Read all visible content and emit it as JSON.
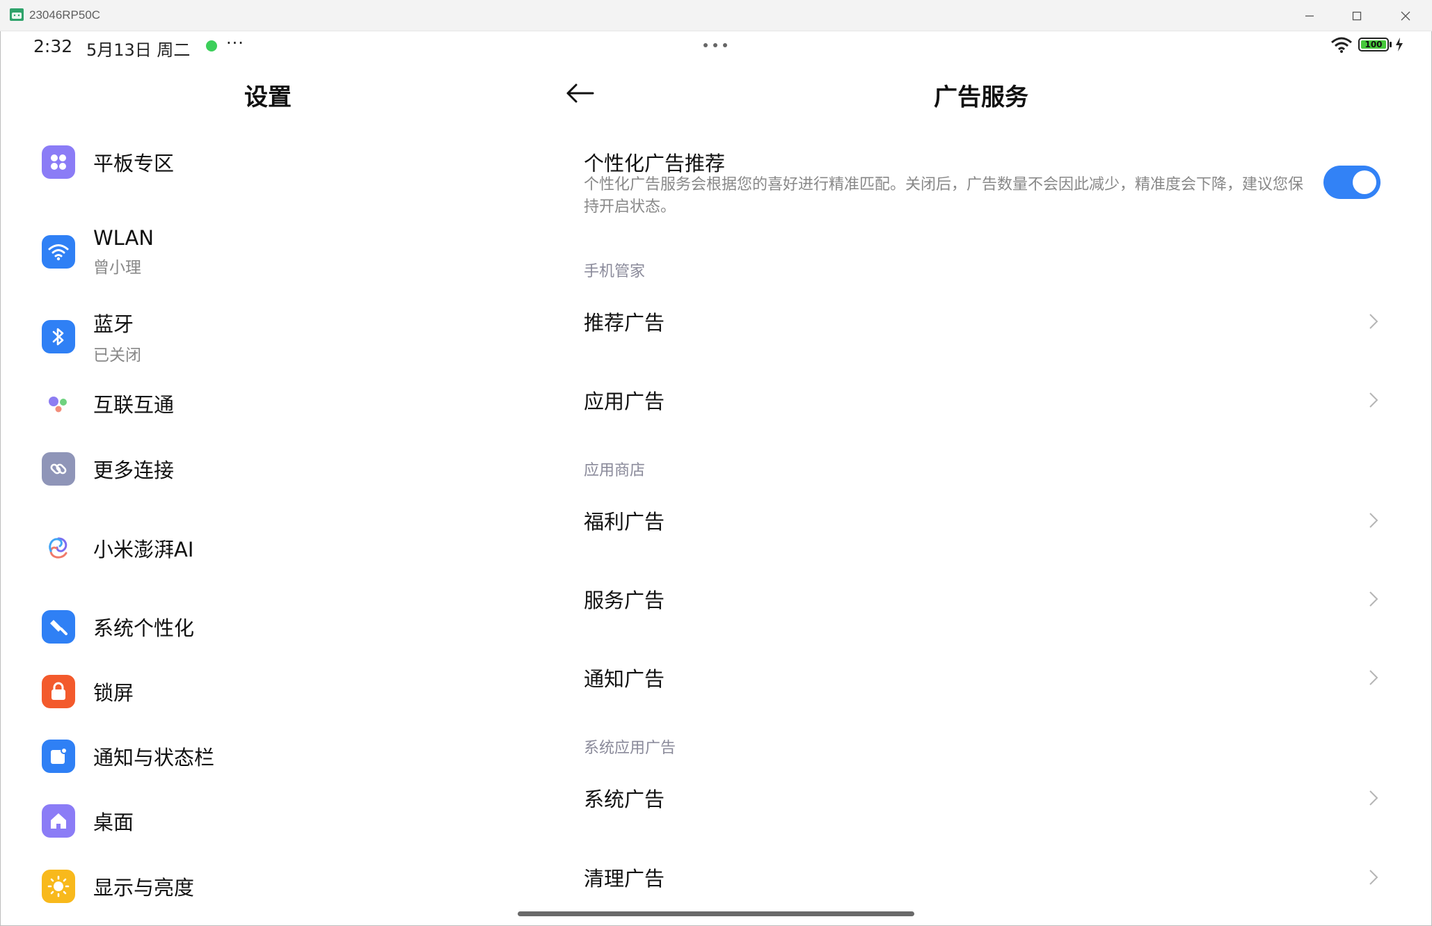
{
  "window": {
    "title": "23046RP50C"
  },
  "status_bar": {
    "time": "2:32",
    "date": "5月13日 周二",
    "more": "···",
    "battery": "100"
  },
  "left_pane": {
    "title": "设置",
    "items": [
      {
        "label": "平板专区",
        "sub": "",
        "icon": "tablet-zone-icon"
      },
      {
        "label": "WLAN",
        "sub": "曾小理",
        "icon": "wifi-icon"
      },
      {
        "label": "蓝牙",
        "sub": "已关闭",
        "icon": "bluetooth-icon"
      },
      {
        "label": "互联互通",
        "sub": "",
        "icon": "interconnect-icon"
      },
      {
        "label": "更多连接",
        "sub": "",
        "icon": "link-icon"
      },
      {
        "label": "小米澎湃AI",
        "sub": "",
        "icon": "ai-icon"
      },
      {
        "label": "系统个性化",
        "sub": "",
        "icon": "personalization-icon"
      },
      {
        "label": "锁屏",
        "sub": "",
        "icon": "lock-icon"
      },
      {
        "label": "通知与状态栏",
        "sub": "",
        "icon": "notification-icon"
      },
      {
        "label": "桌面",
        "sub": "",
        "icon": "home-icon"
      },
      {
        "label": "显示与亮度",
        "sub": "",
        "icon": "brightness-icon"
      }
    ]
  },
  "right_pane": {
    "title": "广告服务",
    "personalized_ads": {
      "title": "个性化广告推荐",
      "description": "个性化广告服务会根据您的喜好进行精准匹配。关闭后，广告数量不会因此减少，精准度会下降，建议您保持开启状态。",
      "enabled": true
    },
    "sections": [
      {
        "header": "手机管家",
        "items": [
          "推荐广告",
          "应用广告"
        ]
      },
      {
        "header": "应用商店",
        "items": [
          "福利广告",
          "服务广告",
          "通知广告"
        ]
      },
      {
        "header": "系统应用广告",
        "items": [
          "系统广告",
          "清理广告"
        ]
      }
    ]
  },
  "colors": {
    "accent": "#3282f6",
    "toggle_on": "#3282f6"
  }
}
